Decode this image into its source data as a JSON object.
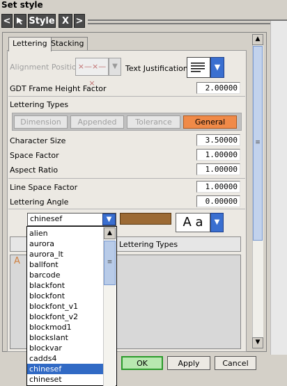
{
  "window": {
    "title": "Set style"
  },
  "toolbar": {
    "back": "<",
    "tool_icon": "arrow-pick-icon",
    "style_label": "Style",
    "close": "X",
    "forward": ">"
  },
  "tabs": [
    {
      "label": "Lettering",
      "active": true
    },
    {
      "label": "Stacking",
      "active": false
    }
  ],
  "form": {
    "alignment_position_label": "Alignment Position",
    "alignment_value": "×—×—×",
    "text_justification_label": "Text Justification",
    "gdt_label": "GDT Frame Height Factor",
    "gdt_value": "2.00000",
    "lettering_types_label": "Lettering Types",
    "lettering_types": [
      {
        "label": "Dimension",
        "active": false
      },
      {
        "label": "Appended",
        "active": false
      },
      {
        "label": "Tolerance",
        "active": false
      },
      {
        "label": "General",
        "active": true
      }
    ],
    "character_size_label": "Character Size",
    "character_size_value": "3.50000",
    "space_factor_label": "Space Factor",
    "space_factor_value": "1.00000",
    "aspect_ratio_label": "Aspect Ratio",
    "aspect_ratio_value": "1.00000",
    "line_space_factor_label": "Line Space Factor",
    "line_space_factor_value": "1.00000",
    "lettering_angle_label": "Lettering Angle",
    "lettering_angle_value": "0.00000",
    "font_selected": "chinesef",
    "font_style_preview": "A a",
    "color_swatch": "#9c6a34",
    "lettering_types_button": "Lettering Types",
    "preview_glyph": "A"
  },
  "font_list": {
    "items": [
      "alien",
      "aurora",
      "aurora_lt",
      "ballfont",
      "barcode",
      "blackfont",
      "blockfont",
      "blockfont_v1",
      "blockfont_v2",
      "blockmod1",
      "blockslant",
      "blockvar",
      "cadds4",
      "chinesef",
      "chineset"
    ],
    "selected": "chinesef"
  },
  "buttons": {
    "ok": "OK",
    "apply": "Apply",
    "cancel": "Cancel"
  },
  "colors": {
    "accent": "#f08a48",
    "selection": "#316ac5",
    "ok_border": "#2a9a2a"
  }
}
